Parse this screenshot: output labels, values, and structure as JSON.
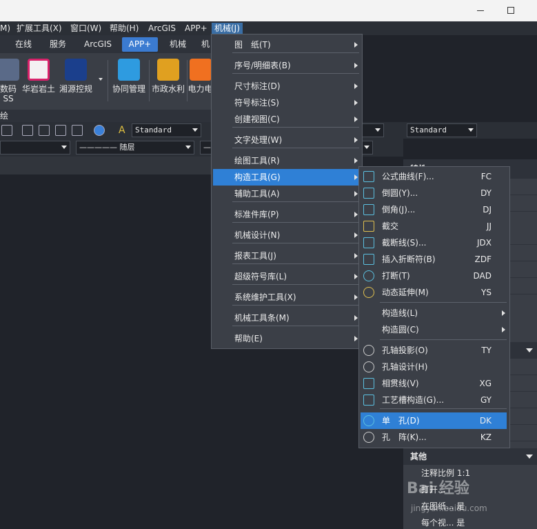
{
  "window": {
    "minimize_label": "",
    "maximize_label": ""
  },
  "menubar": [
    {
      "label": "M)"
    },
    {
      "label": "扩展工具(X)"
    },
    {
      "label": "窗口(W)"
    },
    {
      "label": "帮助(H)"
    },
    {
      "label": "ArcGIS"
    },
    {
      "label": "APP+"
    },
    {
      "label": "机械(J)"
    }
  ],
  "ribbon": {
    "tabs": [
      "在线",
      "服务",
      "ArcGIS",
      "APP+",
      "机械",
      "机"
    ],
    "active_tab": "APP+",
    "buttons": [
      {
        "label": "数码",
        "label2": "SS"
      },
      {
        "label": "华岩岩土"
      },
      {
        "label": "湘源控规"
      },
      {
        "label": "协同管理"
      },
      {
        "label": "市政水利"
      },
      {
        "label": "电力电"
      }
    ],
    "footer": "绘"
  },
  "toolbar": {
    "text_style": "Standard",
    "text_style_right": "Standard",
    "layer_combo": "————— 随层",
    "line_combo": "——"
  },
  "main_menu": [
    {
      "label": "图　纸(T)",
      "submenu": true
    },
    {
      "label": "序号/明细表(B)",
      "submenu": true
    },
    {
      "label": "尺寸标注(D)",
      "submenu": true
    },
    {
      "label": "符号标注(S)",
      "submenu": true
    },
    {
      "label": "创建视图(C)",
      "submenu": true
    },
    {
      "label": "文字处理(W)",
      "submenu": true
    },
    {
      "label": "绘图工具(R)",
      "submenu": true
    },
    {
      "label": "构造工具(G)",
      "submenu": true
    },
    {
      "label": "辅助工具(A)",
      "submenu": true
    },
    {
      "label": "标准件库(P)",
      "submenu": true
    },
    {
      "label": "机械设计(N)",
      "submenu": true
    },
    {
      "label": "报表工具(J)",
      "submenu": true
    },
    {
      "label": "超级符号库(L)",
      "submenu": true
    },
    {
      "label": "系统维护工具(X)",
      "submenu": true
    },
    {
      "label": "机械工具条(M)",
      "submenu": true
    },
    {
      "label": "帮助(E)",
      "submenu": true
    }
  ],
  "sub_menu": [
    {
      "label": "公式曲线(F)...",
      "shortcut": "FC",
      "icon": "formula-curve-icon"
    },
    {
      "label": "倒圆(Y)...",
      "shortcut": "DY",
      "icon": "fillet-icon"
    },
    {
      "label": "倒角(J)...",
      "shortcut": "DJ",
      "icon": "chamfer-icon"
    },
    {
      "label": "截交",
      "shortcut": "JJ",
      "icon": "intersect-icon"
    },
    {
      "label": "截断线(S)...",
      "shortcut": "JDX",
      "icon": "break-line-icon"
    },
    {
      "label": "插入折断符(B)",
      "shortcut": "ZDF",
      "icon": "break-symbol-icon"
    },
    {
      "label": "打断(T)",
      "shortcut": "DAD",
      "icon": "break-icon"
    },
    {
      "label": "动态延伸(M)",
      "shortcut": "YS",
      "icon": "extend-icon"
    },
    {
      "label": "构造线(L)",
      "shortcut": "",
      "icon": ""
    },
    {
      "label": "构造圆(C)",
      "shortcut": "",
      "icon": ""
    },
    {
      "label": "孔轴投影(O)",
      "shortcut": "TY",
      "icon": "hole-shaft-projection-icon"
    },
    {
      "label": "孔轴设计(H)",
      "shortcut": "",
      "icon": "hole-shaft-design-icon"
    },
    {
      "label": "相贯线(V)",
      "shortcut": "XG",
      "icon": "intersection-line-icon"
    },
    {
      "label": "工艺槽构造(G)...",
      "shortcut": "GY",
      "icon": "groove-icon"
    },
    {
      "label": "单　孔(D)",
      "shortcut": "DK",
      "icon": "single-hole-icon"
    },
    {
      "label": "孔　阵(K)...",
      "shortcut": "KZ",
      "icon": "hole-array-icon"
    }
  ],
  "properties": {
    "header": "特性",
    "group_other": "其他",
    "rows": [
      "注释比例 1:1",
      "打开...",
      "在图纸...  是",
      "每个视...  是"
    ]
  },
  "watermark": {
    "main": "Bai 经验",
    "sub": "jingyan.baidu.com"
  },
  "colors": {
    "highlight": "#2f80d6",
    "menu_bg": "#3b3f47",
    "active_tab": "#3b7bd1"
  }
}
